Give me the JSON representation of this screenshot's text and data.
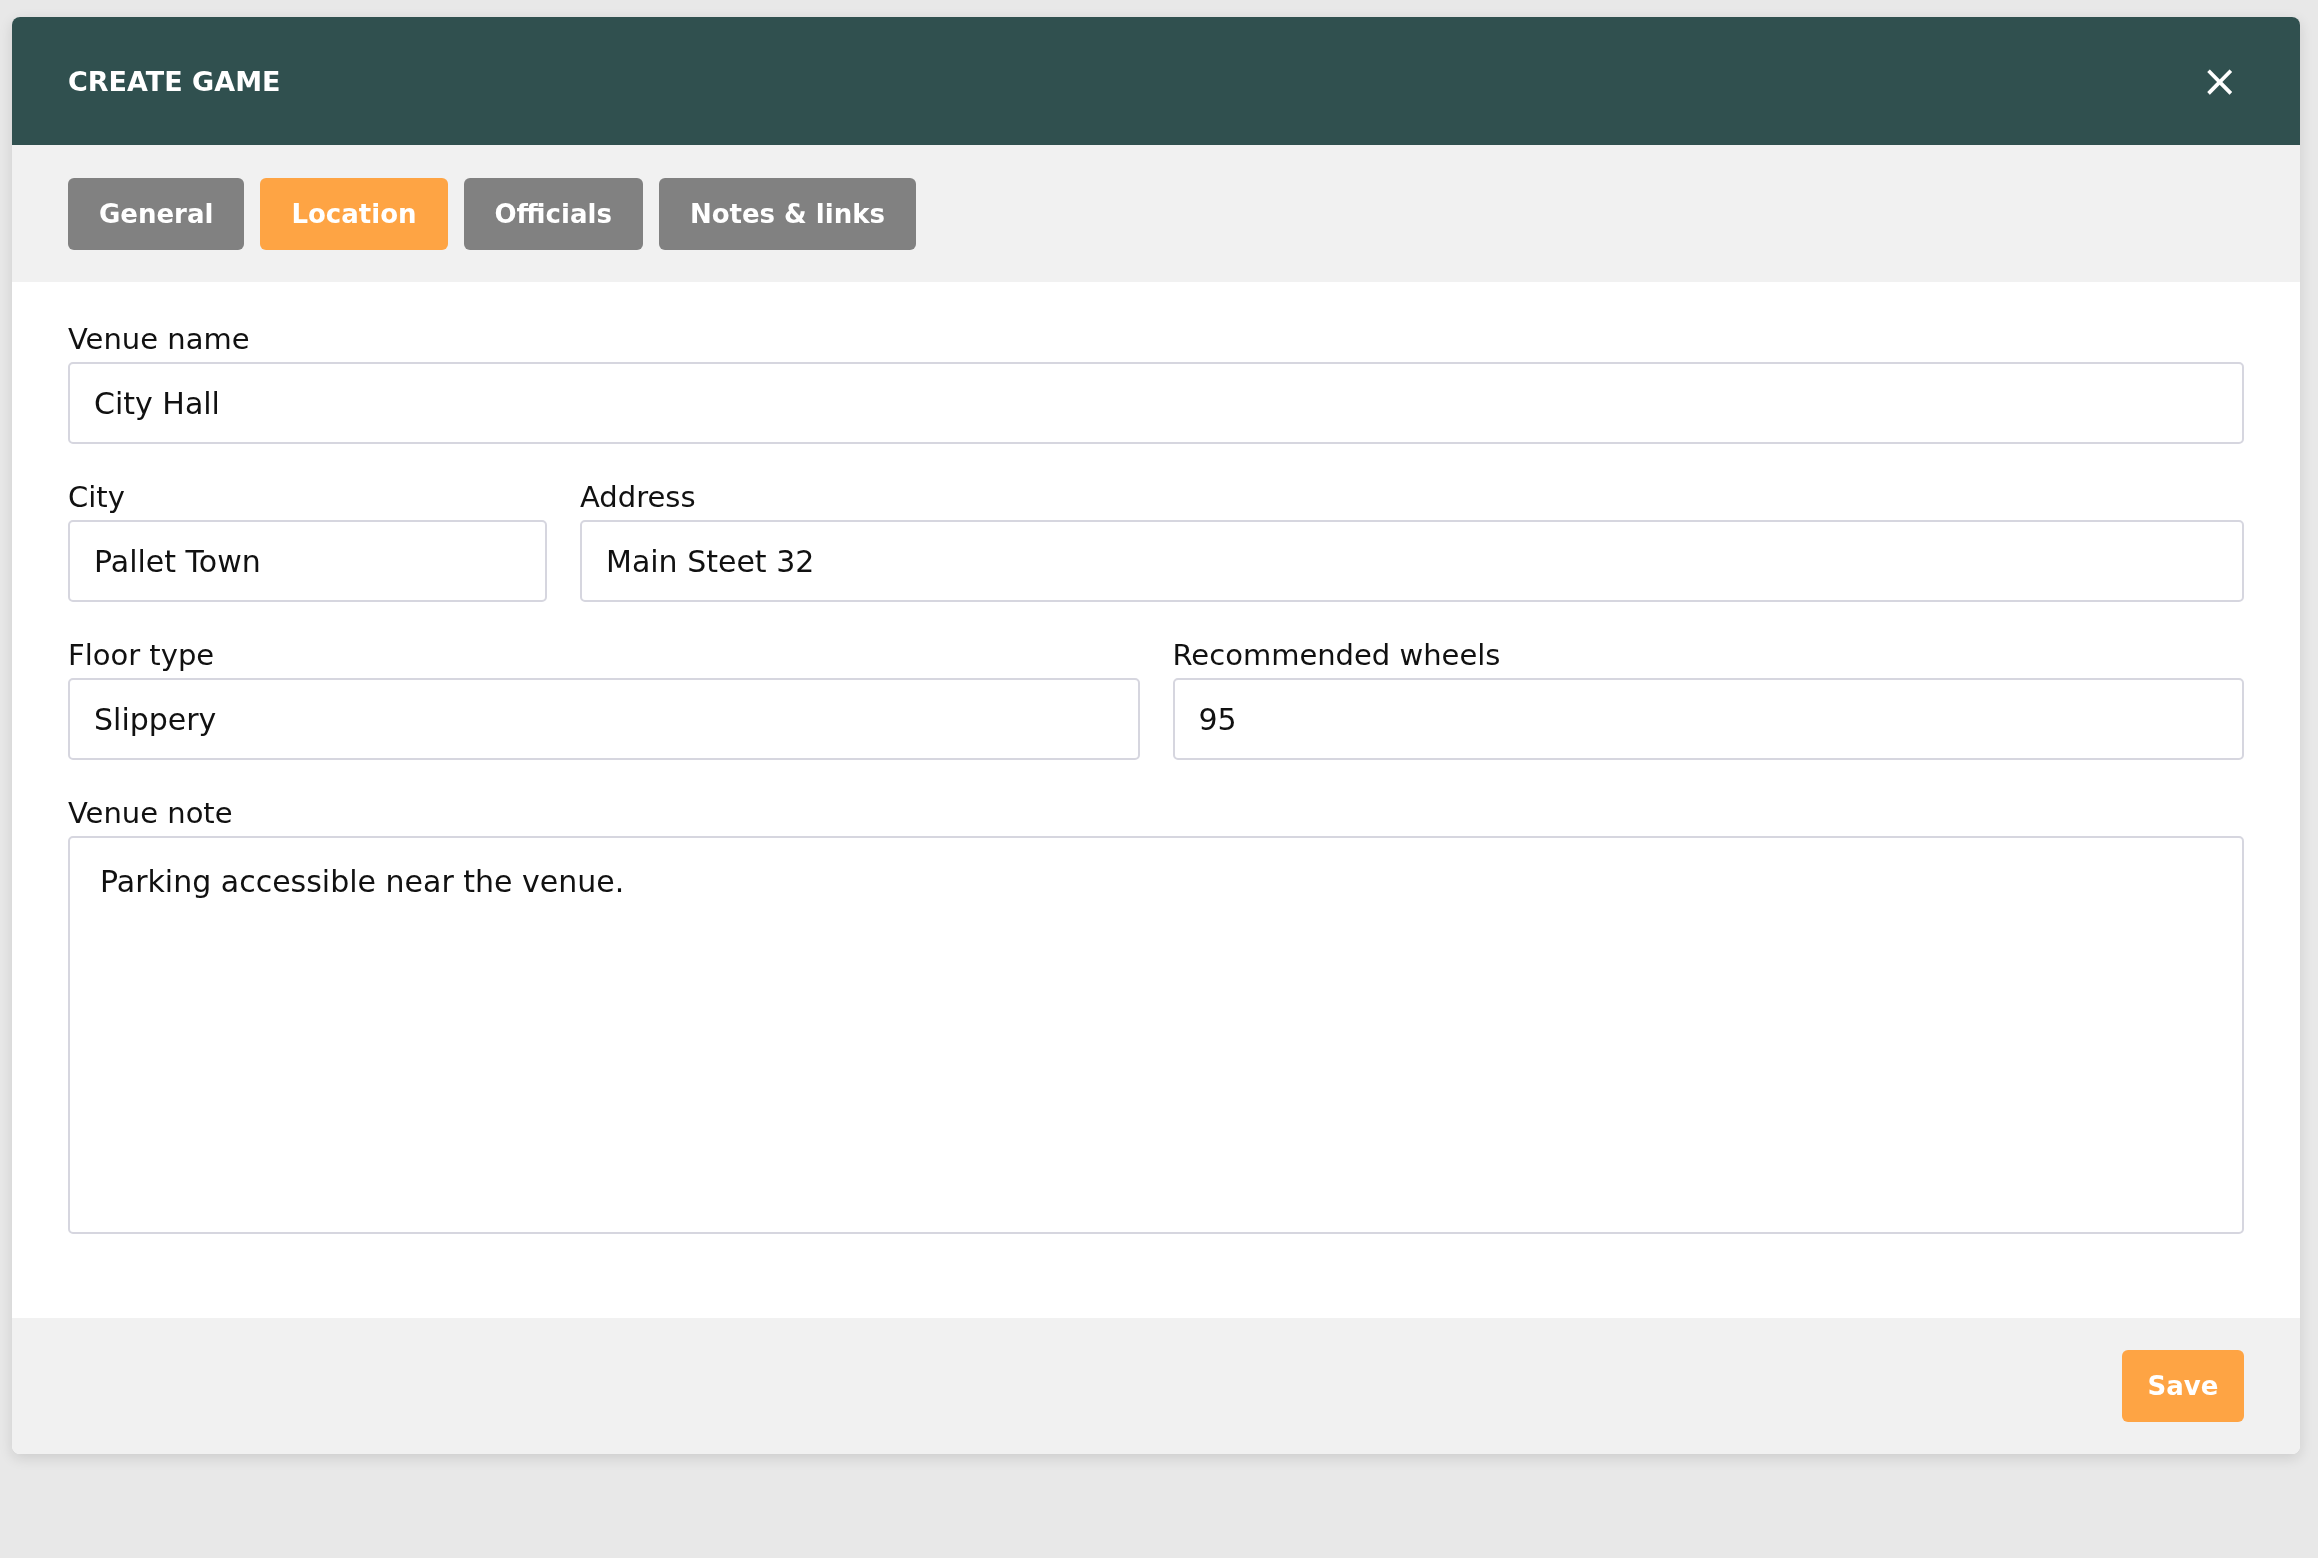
{
  "dialog": {
    "title": "CREATE GAME",
    "close": "×"
  },
  "tabs": [
    {
      "label": "General",
      "selected": false
    },
    {
      "label": "Location",
      "selected": true
    },
    {
      "label": "Officials",
      "selected": false
    },
    {
      "label": "Notes & links",
      "selected": false
    }
  ],
  "rows": [
    [
      {
        "label": "Venue name",
        "value": "City Hall",
        "kind": "input"
      }
    ],
    [
      {
        "label": "City",
        "value": "Pallet Town",
        "kind": "input"
      },
      {
        "label": "Address",
        "value": "Main Steet 32",
        "kind": "input"
      }
    ],
    [
      {
        "label": "Floor type",
        "value": "Slippery",
        "kind": "input"
      },
      {
        "label": "Recommended wheels",
        "value": "95",
        "kind": "input"
      }
    ],
    [
      {
        "label": "Venue note",
        "value": "Parking accessible near the venue.",
        "kind": "textarea"
      }
    ]
  ],
  "buttons": [
    {
      "label": "Save"
    }
  ]
}
